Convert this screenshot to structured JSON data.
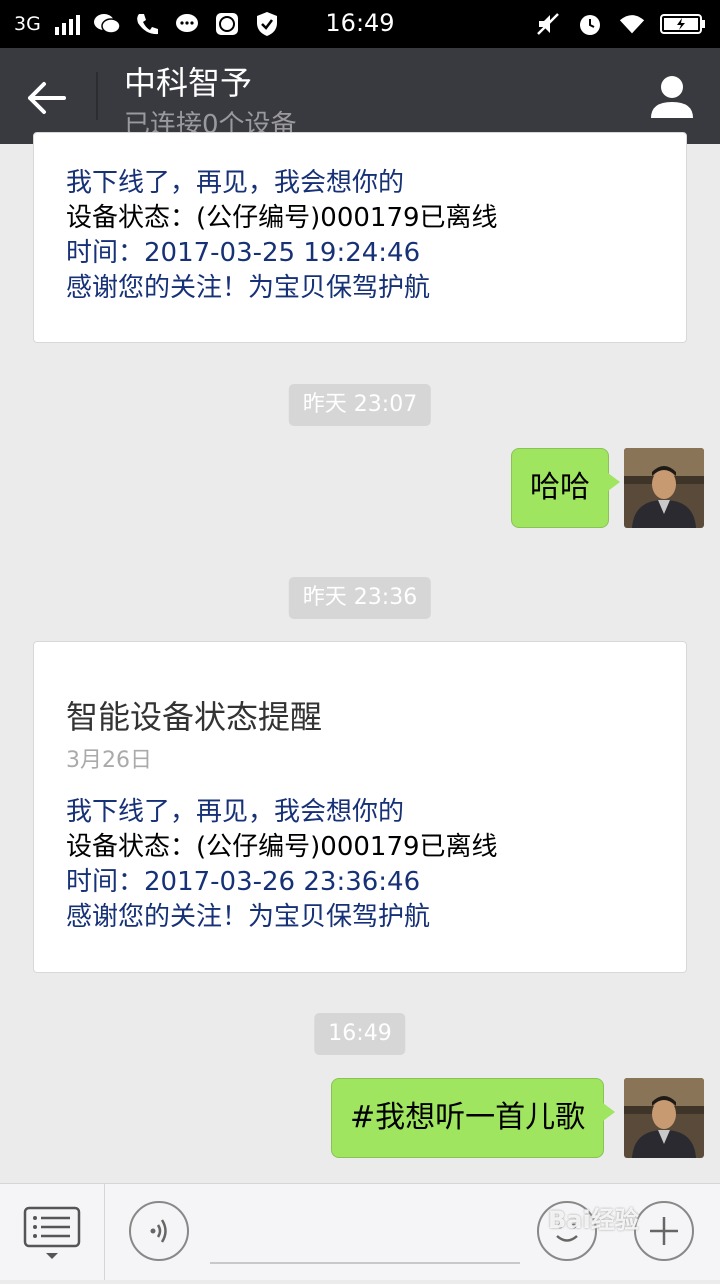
{
  "status_bar": {
    "network": "3G",
    "time": "16:49"
  },
  "header": {
    "title": "中科智予",
    "subtitle": "已连接0个设备"
  },
  "messages": {
    "card1": {
      "line1": "我下线了，再见，我会想你的",
      "line2": "设备状态：(公仔编号)000179已离线",
      "line3": "时间：2017-03-25 19:24:46",
      "line4": "感谢您的关注！为宝贝保驾护航"
    },
    "time1": "昨天 23:07",
    "bubble1": "哈哈",
    "time2": "昨天 23:36",
    "card2": {
      "title": "智能设备状态提醒",
      "date": "3月26日",
      "line1": "我下线了，再见，我会想你的",
      "line2": "设备状态：(公仔编号)000179已离线",
      "line3": "时间：2017-03-26 23:36:46",
      "line4": "感谢您的关注！为宝贝保驾护航"
    },
    "time3": "16:49",
    "bubble2": "#我想听一首儿歌"
  },
  "watermark": "Bai经验",
  "colors": {
    "header_bg": "#393a3f",
    "bubble_green": "#9fe55f",
    "card_text_blue": "#173177",
    "chat_bg": "#ebebeb"
  },
  "icons": {
    "back": "arrow-left-icon",
    "profile": "person-icon",
    "menu": "list-menu-icon",
    "voice": "voice-icon",
    "emoji": "emoji-icon",
    "plus": "plus-icon"
  }
}
